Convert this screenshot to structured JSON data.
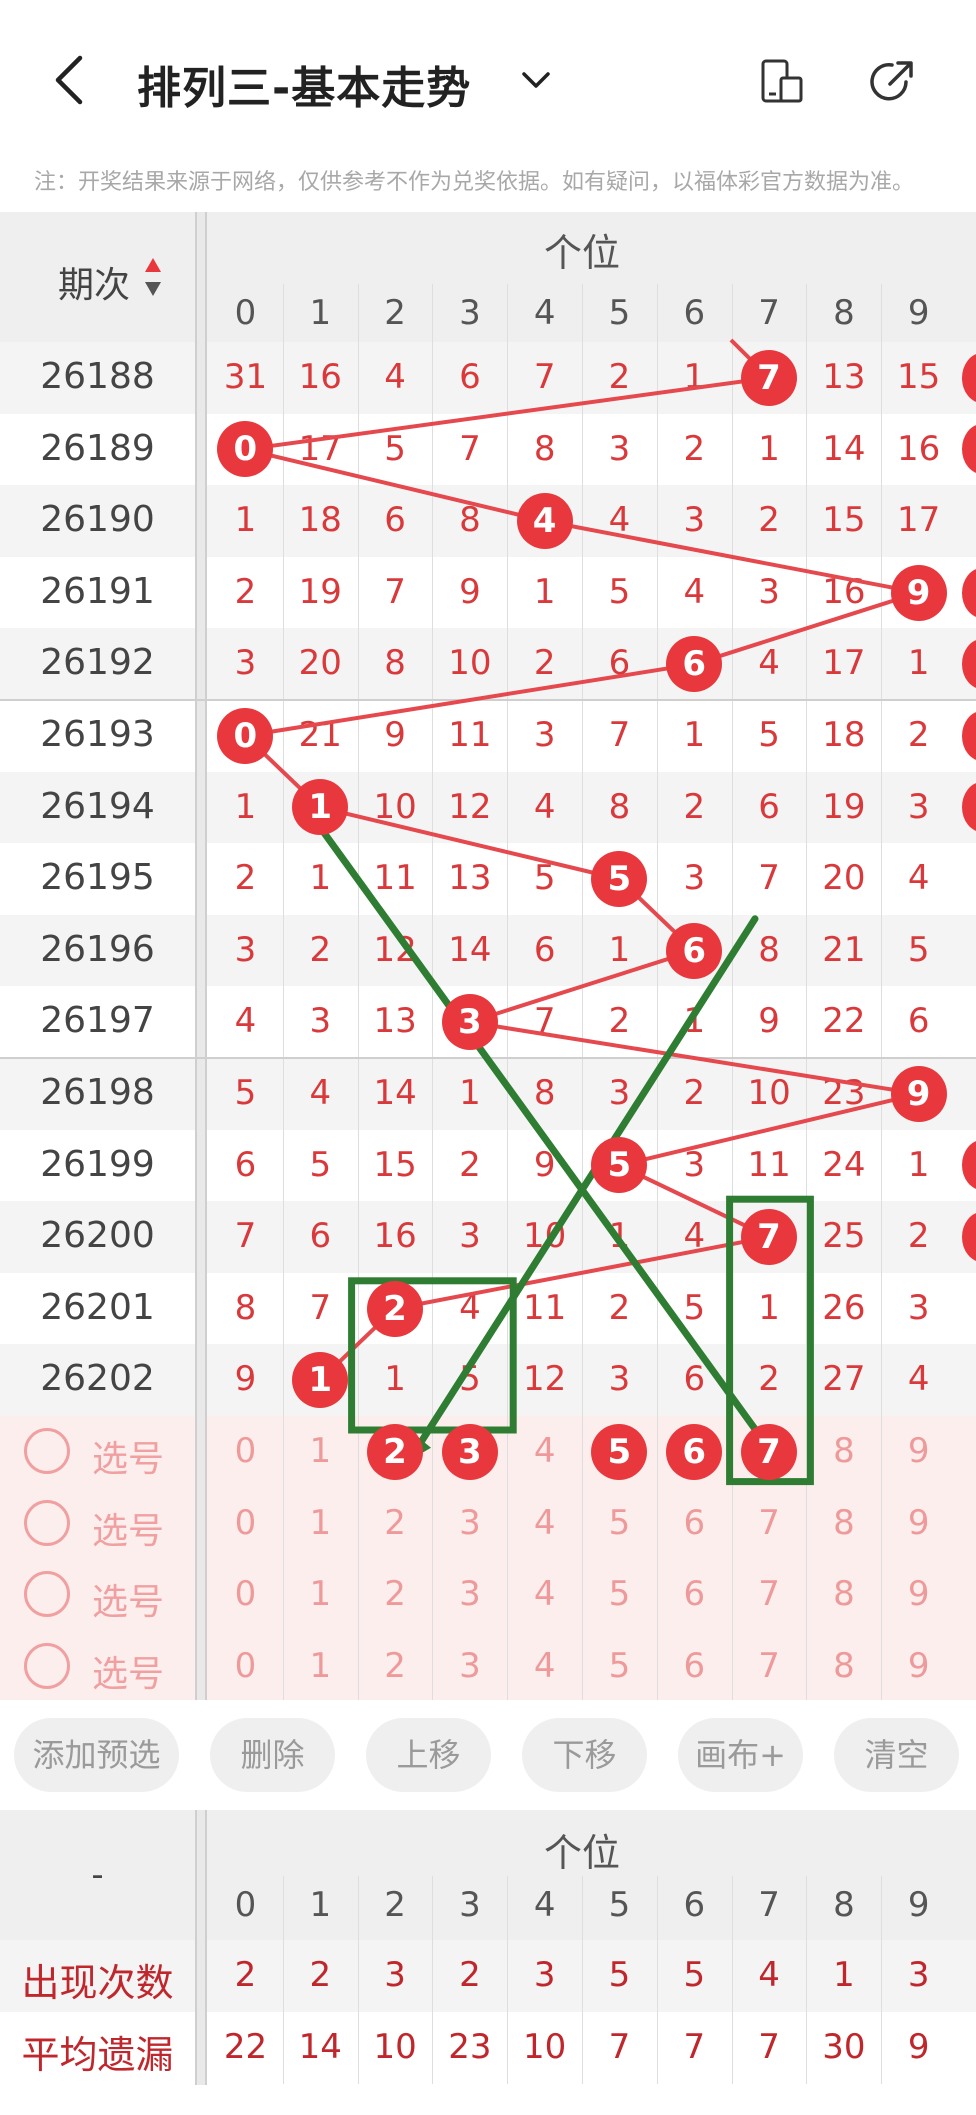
{
  "header": {
    "title": "排列三-基本走势",
    "notice": "注：开奖结果来源于网络，仅供参考不作为兑奖依据。如有疑问，以福体彩官方数据为准。"
  },
  "table": {
    "issue_header": "期次",
    "zone_header": "个位",
    "digits": [
      "0",
      "1",
      "2",
      "3",
      "4",
      "5",
      "6",
      "7",
      "8",
      "9"
    ],
    "rows": [
      {
        "issue": "26188",
        "cells": [
          "31",
          "16",
          "4",
          "6",
          "7",
          "2",
          "1",
          "7",
          "13",
          "15"
        ],
        "hit": 7
      },
      {
        "issue": "26189",
        "cells": [
          "0",
          "17",
          "5",
          "7",
          "8",
          "3",
          "2",
          "1",
          "14",
          "16"
        ],
        "hit": 0
      },
      {
        "issue": "26190",
        "cells": [
          "1",
          "18",
          "6",
          "8",
          "4",
          "4",
          "3",
          "2",
          "15",
          "17"
        ],
        "hit": 4
      },
      {
        "issue": "26191",
        "cells": [
          "2",
          "19",
          "7",
          "9",
          "1",
          "5",
          "4",
          "3",
          "16",
          "9"
        ],
        "hit": 9
      },
      {
        "issue": "26192",
        "cells": [
          "3",
          "20",
          "8",
          "10",
          "2",
          "6",
          "6",
          "4",
          "17",
          "1"
        ],
        "hit": 6
      },
      {
        "issue": "26193",
        "cells": [
          "0",
          "21",
          "9",
          "11",
          "3",
          "7",
          "1",
          "5",
          "18",
          "2"
        ],
        "hit": 0
      },
      {
        "issue": "26194",
        "cells": [
          "1",
          "1",
          "10",
          "12",
          "4",
          "8",
          "2",
          "6",
          "19",
          "3"
        ],
        "hit": 1
      },
      {
        "issue": "26195",
        "cells": [
          "2",
          "1",
          "11",
          "13",
          "5",
          "5",
          "3",
          "7",
          "20",
          "4"
        ],
        "hit": 5
      },
      {
        "issue": "26196",
        "cells": [
          "3",
          "2",
          "12",
          "14",
          "6",
          "1",
          "6",
          "8",
          "21",
          "5"
        ],
        "hit": 6
      },
      {
        "issue": "26197",
        "cells": [
          "4",
          "3",
          "13",
          "3",
          "7",
          "2",
          "1",
          "9",
          "22",
          "6"
        ],
        "hit": 3
      },
      {
        "issue": "26198",
        "cells": [
          "5",
          "4",
          "14",
          "1",
          "8",
          "3",
          "2",
          "10",
          "23",
          "9"
        ],
        "hit": 9
      },
      {
        "issue": "26199",
        "cells": [
          "6",
          "5",
          "15",
          "2",
          "9",
          "5",
          "3",
          "11",
          "24",
          "1"
        ],
        "hit": 5
      },
      {
        "issue": "26200",
        "cells": [
          "7",
          "6",
          "16",
          "3",
          "10",
          "1",
          "4",
          "7",
          "25",
          "2"
        ],
        "hit": 7
      },
      {
        "issue": "26201",
        "cells": [
          "8",
          "7",
          "2",
          "4",
          "11",
          "2",
          "5",
          "1",
          "26",
          "3"
        ],
        "hit": 2
      },
      {
        "issue": "26202",
        "cells": [
          "9",
          "1",
          "1",
          "5",
          "12",
          "3",
          "6",
          "2",
          "27",
          "4"
        ],
        "hit": 1
      }
    ],
    "edge_hits": [
      true,
      true,
      false,
      true,
      true,
      true,
      true,
      false,
      false,
      false,
      false,
      true,
      true,
      false,
      false
    ]
  },
  "picker": {
    "label": "选号",
    "rows": [
      {
        "selected": [
          2,
          3,
          5,
          6,
          7
        ]
      },
      {
        "selected": []
      },
      {
        "selected": []
      },
      {
        "selected": []
      }
    ]
  },
  "buttons": [
    "添加预选",
    "删除",
    "上移",
    "下移",
    "画布+",
    "清空"
  ],
  "stats": {
    "header_dash": "-",
    "zone_header": "个位",
    "digits": [
      "0",
      "1",
      "2",
      "3",
      "4",
      "5",
      "6",
      "7",
      "8",
      "9"
    ],
    "rows": [
      {
        "label": "出现次数",
        "values": [
          "2",
          "2",
          "3",
          "2",
          "3",
          "5",
          "5",
          "4",
          "1",
          "3"
        ]
      },
      {
        "label": "平均遗漏",
        "values": [
          "22",
          "14",
          "10",
          "23",
          "10",
          "7",
          "7",
          "7",
          "30",
          "9"
        ]
      }
    ]
  },
  "colors": {
    "accent": "#e8383d",
    "trend_line": "#e5484d",
    "annotation": "#2e7d32",
    "pick_text": "#f0a0a0",
    "stat_text": "#c0272d"
  },
  "icons": [
    "back-icon",
    "chevron-down-icon",
    "device-icon",
    "share-icon",
    "sort-icon"
  ]
}
